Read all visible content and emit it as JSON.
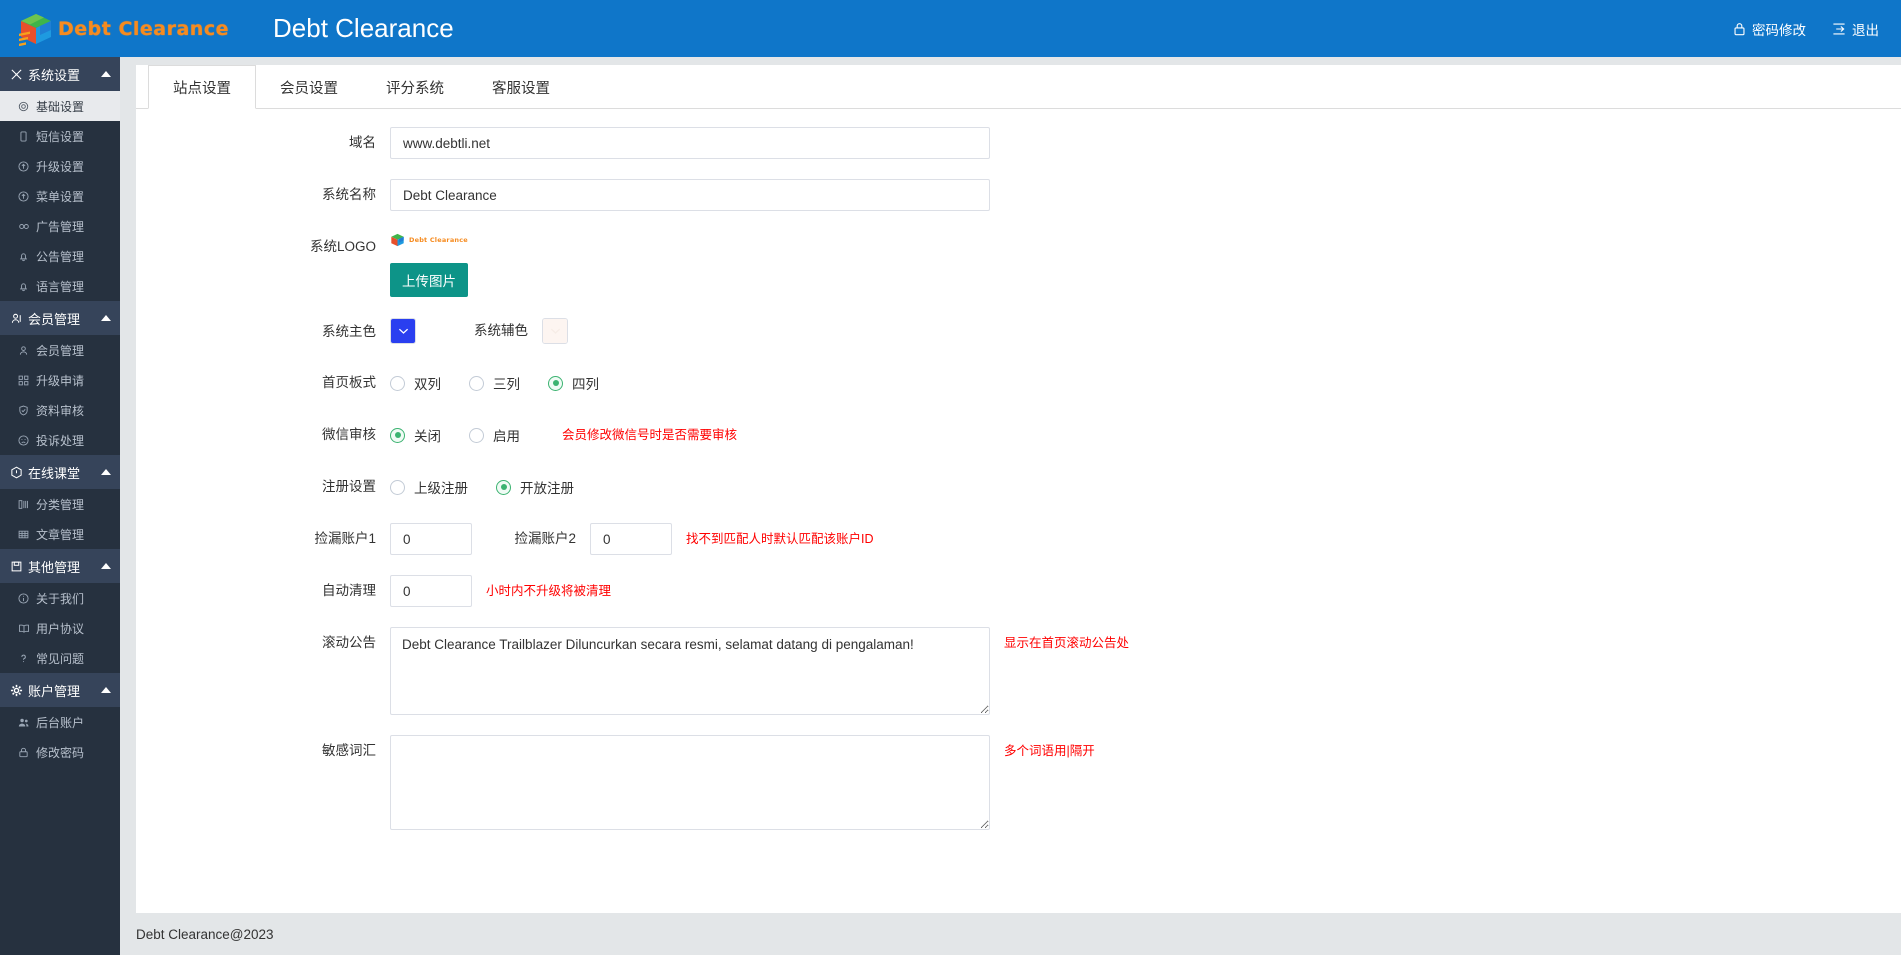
{
  "topbar": {
    "brand_wordmark": "Debt Clearance",
    "title": "Debt Clearance",
    "logo_icon": "cube-logo-icon",
    "actions": [
      {
        "label": "密码修改",
        "icon": "lock-icon"
      },
      {
        "label": "退出",
        "icon": "logout-icon"
      }
    ]
  },
  "sidebar": {
    "groups": [
      {
        "label": "系统设置",
        "icon": "settings-sliders-icon",
        "expanded": true,
        "items": [
          {
            "label": "基础设置",
            "icon": "gear-icon",
            "active": true
          },
          {
            "label": "短信设置",
            "icon": "mobile-icon",
            "active": false
          },
          {
            "label": "升级设置",
            "icon": "arrow-up-circle-icon",
            "active": false
          },
          {
            "label": "菜单设置",
            "icon": "arrow-up-circle-icon",
            "active": false
          },
          {
            "label": "广告管理",
            "icon": "link-icon",
            "active": false
          },
          {
            "label": "公告管理",
            "icon": "bell-icon",
            "active": false
          },
          {
            "label": "语言管理",
            "icon": "bell-icon",
            "active": false
          }
        ]
      },
      {
        "label": "会员管理",
        "icon": "user-badge-icon",
        "expanded": true,
        "items": [
          {
            "label": "会员管理",
            "icon": "user-icon",
            "active": false
          },
          {
            "label": "升级申请",
            "icon": "grid-icon",
            "active": false
          },
          {
            "label": "资料审核",
            "icon": "shield-check-icon",
            "active": false
          },
          {
            "label": "投诉处理",
            "icon": "sad-face-icon",
            "active": false
          }
        ]
      },
      {
        "label": "在线课堂",
        "icon": "hexagon-check-icon",
        "expanded": true,
        "items": [
          {
            "label": "分类管理",
            "icon": "columns-icon",
            "active": false
          },
          {
            "label": "文章管理",
            "icon": "table-icon",
            "active": false
          }
        ]
      },
      {
        "label": "其他管理",
        "icon": "save-icon",
        "expanded": true,
        "items": [
          {
            "label": "关于我们",
            "icon": "info-circle-icon",
            "active": false
          },
          {
            "label": "用户协议",
            "icon": "book-icon",
            "active": false
          },
          {
            "label": "常见问题",
            "icon": "question-mark-icon",
            "active": false
          }
        ]
      },
      {
        "label": "账户管理",
        "icon": "gear-icon",
        "expanded": true,
        "items": [
          {
            "label": "后台账户",
            "icon": "users-icon",
            "active": false
          },
          {
            "label": "修改密码",
            "icon": "lock-icon",
            "active": false
          }
        ]
      }
    ]
  },
  "tabs": [
    {
      "label": "站点设置",
      "active": true
    },
    {
      "label": "会员设置",
      "active": false
    },
    {
      "label": "评分系统",
      "active": false
    },
    {
      "label": "客服设置",
      "active": false
    }
  ],
  "form": {
    "domain": {
      "label": "域名",
      "value": "www.debtli.net",
      "placeholder": ""
    },
    "system_name": {
      "label": "系统名称",
      "value": "Debt Clearance",
      "placeholder": ""
    },
    "system_logo": {
      "label": "系统LOGO",
      "preview_text": "Debt Clearance",
      "upload_button": "上传图片"
    },
    "primary_color": {
      "label": "系统主色",
      "value": "#2a3ff0",
      "icon": "chevron-down-icon"
    },
    "secondary_color": {
      "label": "系统辅色",
      "value": "#fdf5f1",
      "icon": "chevron-down-icon"
    },
    "home_layout": {
      "label": "首页板式",
      "options": [
        {
          "label": "双列",
          "checked": false
        },
        {
          "label": "三列",
          "checked": false
        },
        {
          "label": "四列",
          "checked": true
        }
      ]
    },
    "wechat_review": {
      "label": "微信审核",
      "options": [
        {
          "label": "关闭",
          "checked": true
        },
        {
          "label": "启用",
          "checked": false
        }
      ],
      "hint": "会员修改微信号时是否需要审核"
    },
    "register_setting": {
      "label": "注册设置",
      "options": [
        {
          "label": "上级注册",
          "checked": false
        },
        {
          "label": "开放注册",
          "checked": true
        }
      ]
    },
    "pickup_account_1": {
      "label": "捡漏账户1",
      "value": "0"
    },
    "pickup_account_2": {
      "label": "捡漏账户2",
      "value": "0"
    },
    "pickup_hint": "找不到匹配人时默认匹配该账户ID",
    "auto_clean": {
      "label": "自动清理",
      "value": "0",
      "hint": "小时内不升级将被清理"
    },
    "scroll_notice": {
      "label": "滚动公告",
      "value": "Debt Clearance Trailblazer Diluncurkan secara resmi, selamat datang di pengalaman!",
      "hint": "显示在首页滚动公告处"
    },
    "sensitive_words": {
      "label": "敏感词汇",
      "value": "",
      "hint": "多个词语用|隔开"
    }
  },
  "footer": {
    "text": "Debt Clearance@2023"
  },
  "colors": {
    "topbar_bg": "#0f76c9",
    "sidebar_bg": "#26313f",
    "sidebar_group_bg": "#36445a",
    "accent_brand": "#f68b1f",
    "upload_button": "#0d9488",
    "hint_red": "#ff0000",
    "radio_green": "#3cb371",
    "page_bg": "#e3e6e8"
  }
}
